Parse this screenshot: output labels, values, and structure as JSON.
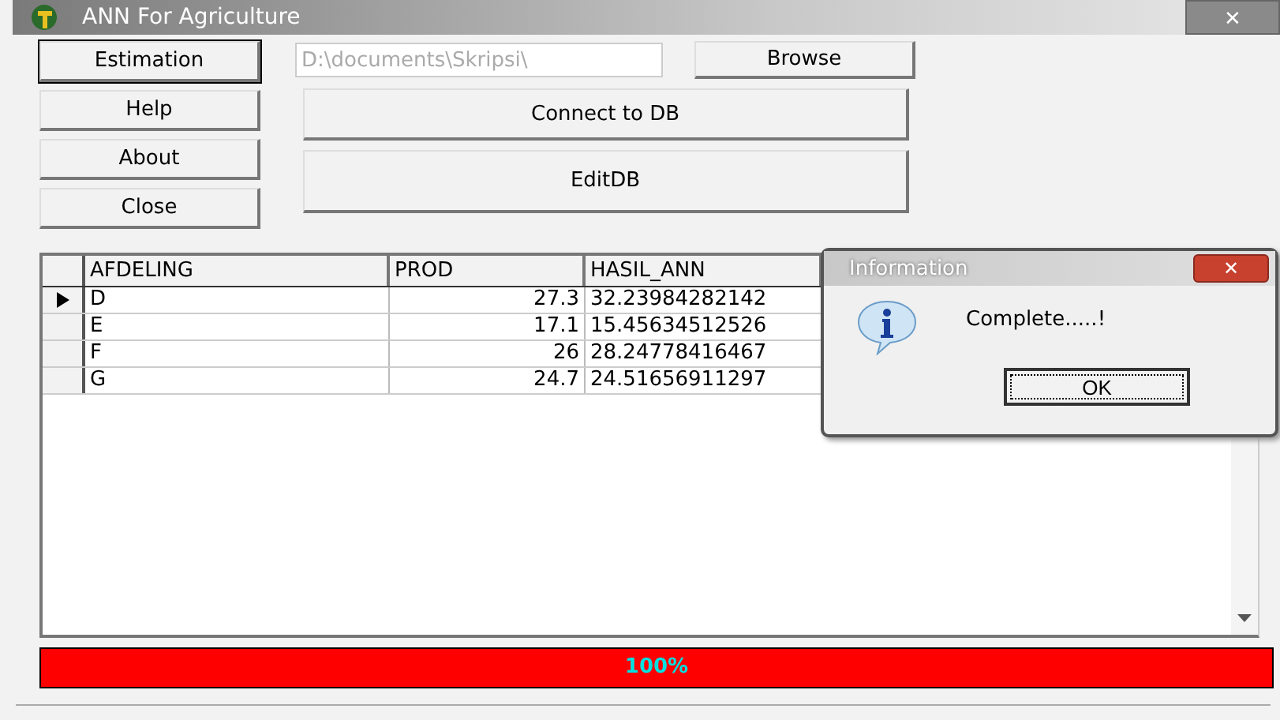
{
  "window": {
    "title": "ANN For Agriculture",
    "close": "✕"
  },
  "side_buttons": [
    {
      "label": "Estimation",
      "selected": true
    },
    {
      "label": "Help",
      "selected": false
    },
    {
      "label": "About",
      "selected": false
    },
    {
      "label": "Close",
      "selected": false
    }
  ],
  "path_field": {
    "value": "D:\\documents\\Skripsi\\"
  },
  "browse_button": "Browse",
  "connect_button": "Connect to DB",
  "edit_button": "EditDB",
  "table": {
    "columns": [
      "AFDELING",
      "PROD",
      "HASIL_ANN"
    ],
    "rows": [
      {
        "selected": true,
        "cells": [
          "D",
          "27.3",
          "32.23984282142"
        ]
      },
      {
        "selected": false,
        "cells": [
          "E",
          "17.1",
          "15.45634512526"
        ]
      },
      {
        "selected": false,
        "cells": [
          "F",
          "26",
          "28.24778416467"
        ]
      },
      {
        "selected": false,
        "cells": [
          "G",
          "24.7",
          "24.51656911297"
        ]
      }
    ]
  },
  "progress": {
    "level": 1,
    "label": "100%"
  },
  "dialog": {
    "title": "Information",
    "close": "✕",
    "message": "Complete.....!",
    "button": "OK"
  }
}
